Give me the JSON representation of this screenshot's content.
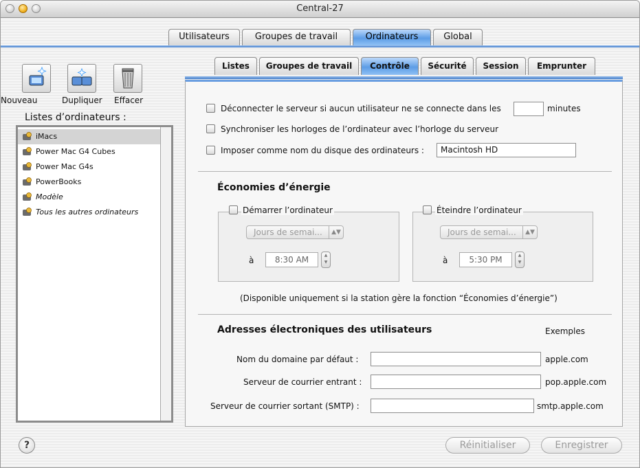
{
  "window": {
    "title": "Central-27"
  },
  "top_tabs": [
    {
      "label": "Utilisateurs"
    },
    {
      "label": "Groupes de travail"
    },
    {
      "label": "Ordinateurs",
      "selected": true
    },
    {
      "label": "Global"
    }
  ],
  "toolbar": {
    "new_label": "Nouveau",
    "duplicate_label": "Dupliquer",
    "delete_label": "Effacer"
  },
  "computer_lists": {
    "label": "Listes d’ordinateurs :",
    "items": [
      {
        "label": "iMacs",
        "selected": true
      },
      {
        "label": "Power Mac G4 Cubes"
      },
      {
        "label": "Power Mac G4s"
      },
      {
        "label": "PowerBooks"
      },
      {
        "label": "Modèle",
        "italic": true
      },
      {
        "label": "Tous les autres ordinateurs",
        "italic": true
      }
    ]
  },
  "sub_tabs": [
    {
      "label": "Listes"
    },
    {
      "label": "Groupes de travail"
    },
    {
      "label": "Contrôle",
      "selected": true
    },
    {
      "label": "Sécurité"
    },
    {
      "label": "Session"
    },
    {
      "label": "Emprunter"
    }
  ],
  "control": {
    "disconnect_label": "Déconnecter le serveur si aucun utilisateur ne se connecte dans les",
    "disconnect_minutes_value": "",
    "minutes_label": "minutes",
    "sync_clock_label": "Synchroniser les horloges de l’ordinateur avec l’horloge du serveur",
    "force_disk_name_label": "Imposer comme nom du disque des ordinateurs :",
    "disk_name_value": "Macintosh HD"
  },
  "energy": {
    "title": "Économies d’énergie",
    "startup": {
      "label": "Démarrer l’ordinateur",
      "days": "Jours de semai...",
      "at_label": "à",
      "time": "8:30 AM"
    },
    "shutdown": {
      "label": "Éteindre l’ordinateur",
      "days": "Jours de semai...",
      "at_label": "à",
      "time": "5:30 PM"
    },
    "note": "(Disponible uniquement si la station gère la fonction “Économies d’énergie”)"
  },
  "email": {
    "title": "Adresses électroniques des utilisateurs",
    "examples_label": "Exemples",
    "domain_label": "Nom du domaine par défaut :",
    "domain_value": "",
    "domain_example": "apple.com",
    "incoming_label": "Serveur de courrier entrant :",
    "incoming_value": "",
    "incoming_example": "pop.apple.com",
    "outgoing_label": "Serveur de courrier sortant (SMTP) :",
    "outgoing_value": "",
    "outgoing_example": "smtp.apple.com"
  },
  "footer": {
    "help_label": "?",
    "reset_label": "Réinitialiser",
    "save_label": "Enregistrer"
  },
  "colors": {
    "accent": "#5d9de6",
    "selection": "#d4d4d4"
  }
}
